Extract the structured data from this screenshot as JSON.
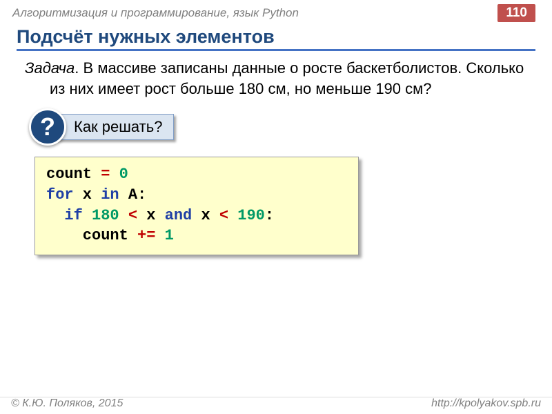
{
  "header": {
    "title": "Алгоритмизация и программирование, язык Python",
    "page_number": "110"
  },
  "section_title": "Подсчёт нужных элементов",
  "task": {
    "label": "Задача",
    "text": "В массиве записаны данные о росте баскетболистов. Сколько из них имеет рост больше 180 см, но меньше 190 см?"
  },
  "hint": {
    "mark": "?",
    "text": "Как решать?"
  },
  "code": {
    "l1a": "count ",
    "l1op": "=",
    "l1b": " ",
    "l1n": "0",
    "l2a": "for",
    "l2b": " x ",
    "l2c": "in",
    "l2d": " A:",
    "l3a": "  ",
    "l3b": "if",
    "l3c": " ",
    "l3n1": "180",
    "l3d": " ",
    "l3op1": "<",
    "l3e": " x ",
    "l3f": "and",
    "l3g": " x ",
    "l3op2": "<",
    "l3h": " ",
    "l3n2": "190",
    "l3i": ":",
    "l4a": "    count ",
    "l4op": "+=",
    "l4b": " ",
    "l4n": "1"
  },
  "footer": {
    "left": "© К.Ю. Поляков, 2015",
    "right": "http://kpolyakov.spb.ru"
  }
}
